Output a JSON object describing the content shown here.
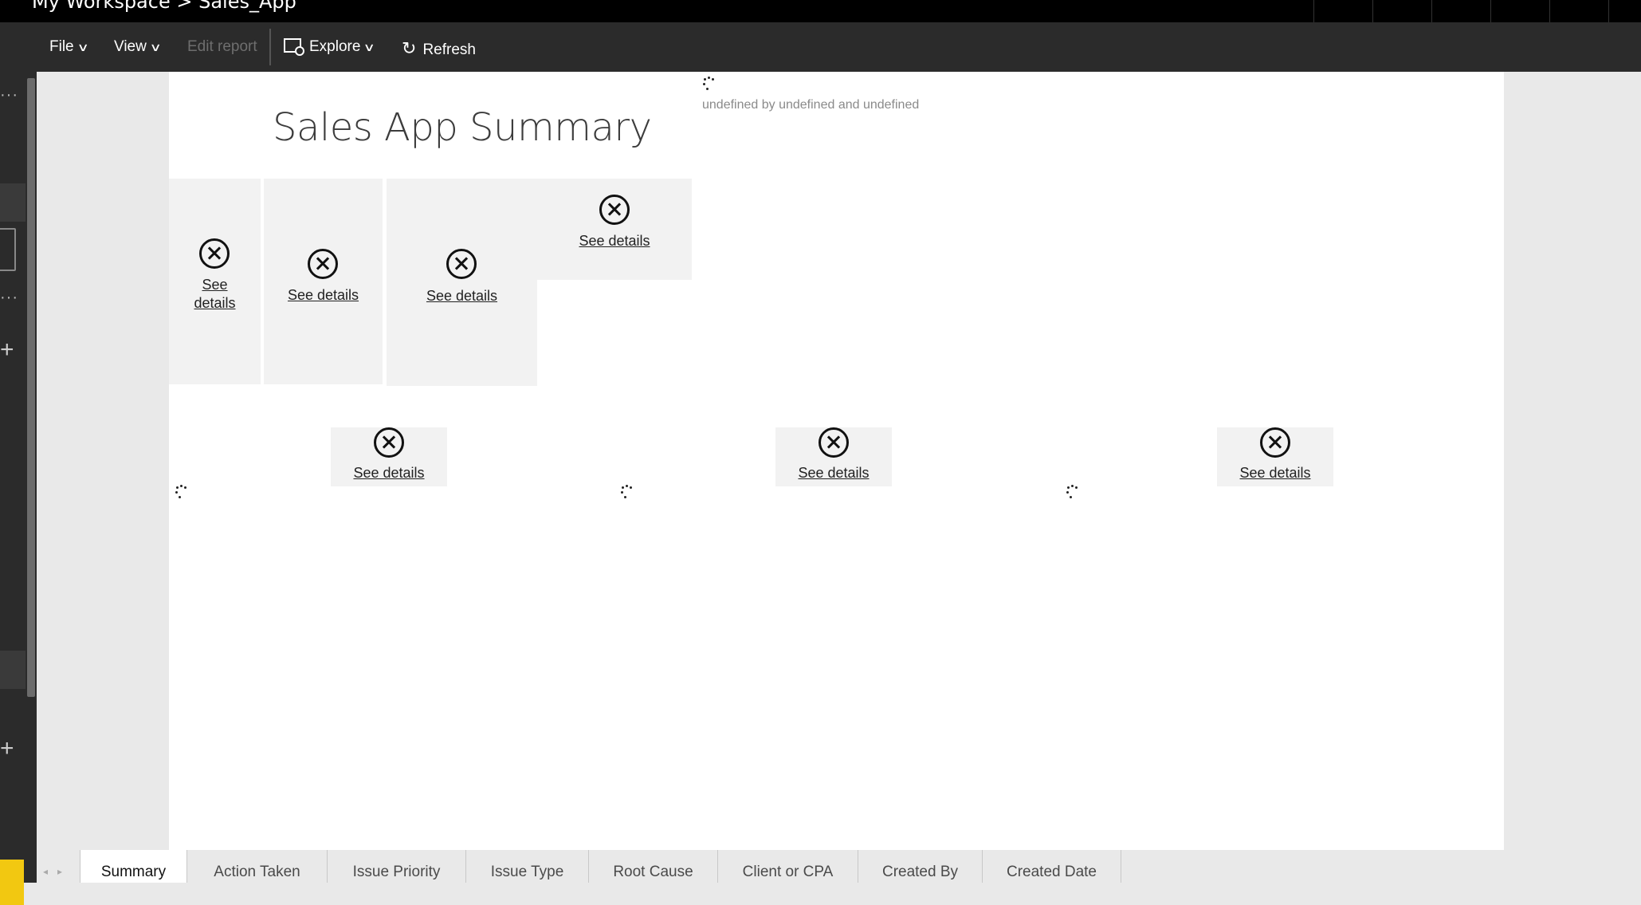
{
  "window": {
    "title": "My Workspace > Sales_App"
  },
  "toolbar": {
    "file_label": "File",
    "view_label": "View",
    "edit_report_label": "Edit report",
    "explore_label": "Explore",
    "refresh_label": "Refresh"
  },
  "report": {
    "title": "Sales App Summary",
    "subtitle": "undefined by undefined and undefined",
    "see_details": "See details",
    "see_details_wrapped_1": "See",
    "see_details_wrapped_2": "details"
  },
  "tabs": [
    {
      "label": "Summary",
      "active": true
    },
    {
      "label": "Action Taken"
    },
    {
      "label": "Issue Priority"
    },
    {
      "label": "Issue Type"
    },
    {
      "label": "Root Cause"
    },
    {
      "label": "Client or CPA"
    },
    {
      "label": "Created By"
    },
    {
      "label": "Created Date"
    }
  ],
  "colors": {
    "accent_yellow": "#f2c811",
    "toolbar_bg": "#2b2b2b",
    "canvas_bg": "#ffffff",
    "tile_bg": "#f2f2f2"
  },
  "icons": [
    "chevron-down-icon",
    "explore-icon",
    "refresh-icon",
    "error-icon",
    "loading-spinner-icon",
    "add-icon",
    "more-icon"
  ]
}
